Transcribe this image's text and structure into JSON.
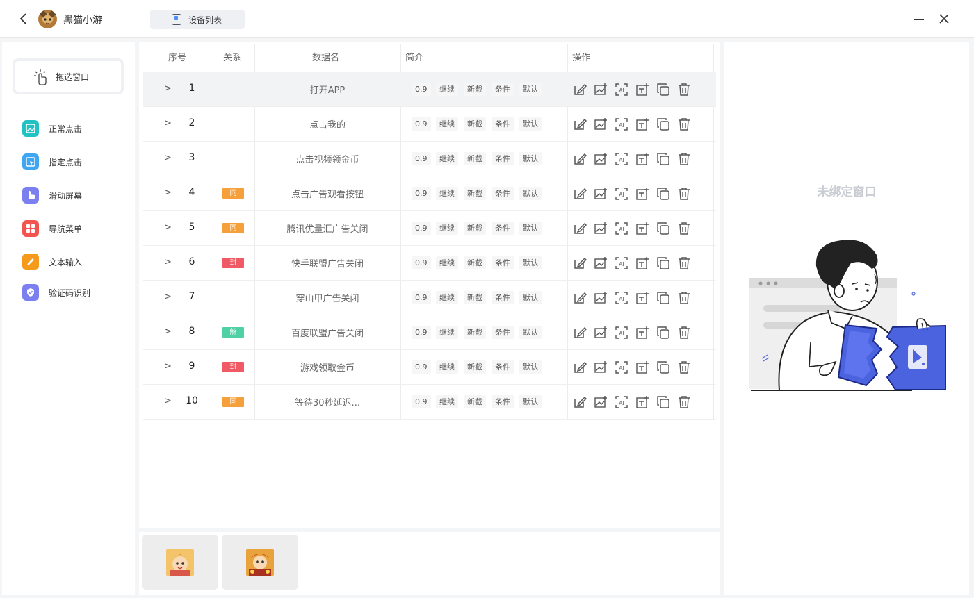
{
  "titlebar": {
    "app_name": "黑猫小游",
    "device_tab_label": "设备列表"
  },
  "sidebar": {
    "drag_label": "拖选窗口",
    "items": [
      {
        "label": "正常点击",
        "color": "#22c1c3",
        "icon": "image-icon"
      },
      {
        "label": "指定点击",
        "color": "#3fa6f2",
        "icon": "cursor-icon"
      },
      {
        "label": "滑动屏幕",
        "color": "#7b7ff0",
        "icon": "swipe-icon"
      },
      {
        "label": "导航菜单",
        "color": "#f2554f",
        "icon": "grid-icon"
      },
      {
        "label": "文本输入",
        "color": "#f59a1b",
        "icon": "pencil-icon"
      },
      {
        "label": "验证码识别",
        "color": "#7b7ff0",
        "icon": "shield-icon"
      }
    ]
  },
  "table": {
    "headers": {
      "index": "序号",
      "relation": "关系",
      "name": "数据名",
      "summary": "简介",
      "actions": "操作"
    },
    "chips": [
      "0.9",
      "继续",
      "新截",
      "条件",
      "默认"
    ],
    "rows": [
      {
        "arrow": ">",
        "num": "1",
        "tag": "",
        "tag_color": "",
        "name": "打开APP",
        "selected": true
      },
      {
        "arrow": ">",
        "num": "2",
        "tag": "",
        "tag_color": "",
        "name": "点击我的"
      },
      {
        "arrow": ">",
        "num": "3",
        "tag": "",
        "tag_color": "",
        "name": "点击视频领金币"
      },
      {
        "arrow": ">",
        "num": "4",
        "tag": "同",
        "tag_color": "#f5a03a",
        "name": "点击广告观看按钮"
      },
      {
        "arrow": ">",
        "num": "5",
        "tag": "同",
        "tag_color": "#f5a03a",
        "name": "腾讯优量汇广告关闭"
      },
      {
        "arrow": ">",
        "num": "6",
        "tag": "封",
        "tag_color": "#ef5a64",
        "name": "快手联盟广告关闭"
      },
      {
        "arrow": ">",
        "num": "7",
        "tag": "",
        "tag_color": "",
        "name": "穿山甲广告关闭"
      },
      {
        "arrow": ">",
        "num": "8",
        "tag": "解",
        "tag_color": "#4fd1a6",
        "name": "百度联盟广告关闭"
      },
      {
        "arrow": ">",
        "num": "9",
        "tag": "封",
        "tag_color": "#ef5a64",
        "name": "游戏领取金币"
      },
      {
        "arrow": ">",
        "num": "10",
        "tag": "同",
        "tag_color": "#f5a03a",
        "name": "等待30秒延迟..."
      }
    ],
    "action_icons": [
      "edit-icon",
      "image-add-icon",
      "ai-scan-icon",
      "text-add-icon",
      "copy-icon",
      "delete-icon"
    ]
  },
  "right_panel": {
    "empty_text": "未绑定窗口"
  },
  "thumbnails": [
    "game-thumbnail-1",
    "game-thumbnail-2"
  ]
}
